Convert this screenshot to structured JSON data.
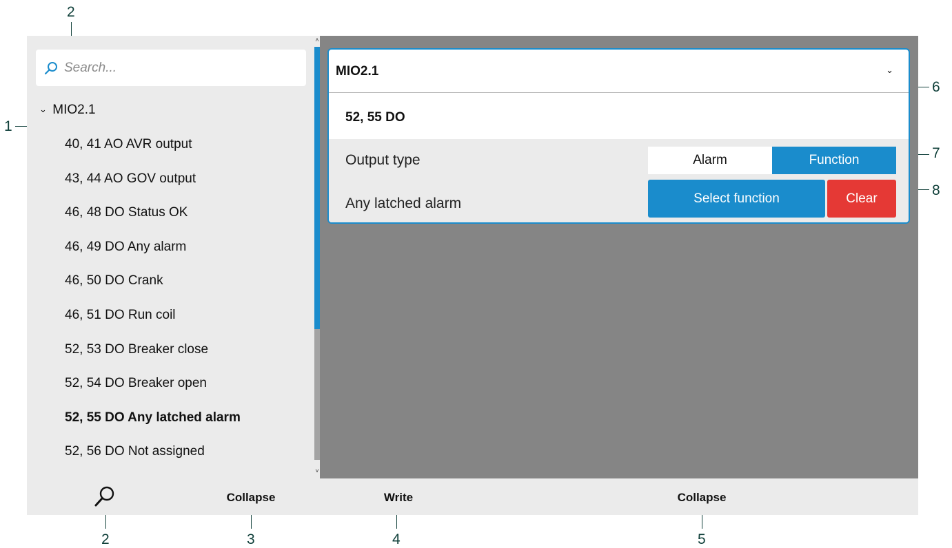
{
  "callouts": {
    "search_field": "2",
    "tree": "1",
    "search_button": "2",
    "collapse_left": "3",
    "write": "4",
    "collapse_right": "5",
    "selector": "6",
    "output_type": "7",
    "function_buttons": "8"
  },
  "sidebar": {
    "search_placeholder": "Search...",
    "root_label": "MIO2.1",
    "items": [
      {
        "label": "40, 41 AO AVR output",
        "selected": false
      },
      {
        "label": "43, 44 AO GOV output",
        "selected": false
      },
      {
        "label": "46, 48 DO Status OK",
        "selected": false
      },
      {
        "label": "46, 49 DO Any alarm",
        "selected": false
      },
      {
        "label": "46, 50 DO Crank",
        "selected": false
      },
      {
        "label": "46, 51 DO Run coil",
        "selected": false
      },
      {
        "label": "52, 53 DO Breaker close",
        "selected": false
      },
      {
        "label": "52, 54 DO Breaker open",
        "selected": false
      },
      {
        "label": "52, 55 DO Any latched alarm",
        "selected": true
      },
      {
        "label": "52, 56 DO Not assigned",
        "selected": false
      }
    ]
  },
  "detail": {
    "module": "MIO2.1",
    "terminal": "52, 55 DO",
    "output_type_label": "Output type",
    "output_type_options": [
      "Alarm",
      "Function"
    ],
    "output_type_selected": "Function",
    "function_label": "Any latched alarm",
    "select_function_button": "Select function",
    "clear_button": "Clear"
  },
  "bottom_bar": {
    "collapse_left": "Collapse",
    "write": "Write",
    "collapse_right": "Collapse"
  },
  "colors": {
    "accent": "#1a8ccc",
    "danger": "#e53935",
    "panel_bg": "#ebebeb",
    "content_bg": "#858585",
    "callout": "#10403a"
  },
  "icons": {
    "search": "search-icon",
    "expand": "chevron-down-icon"
  }
}
